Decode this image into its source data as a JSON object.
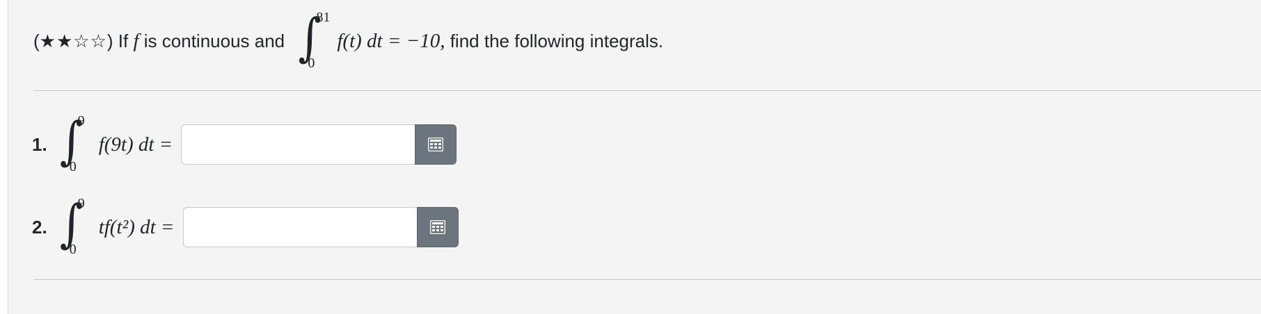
{
  "problem": {
    "difficulty_open": "(",
    "stars": "★★☆☆",
    "difficulty_close": ")",
    "text_before": " If ",
    "var_f": "f",
    "text_middle": " is continuous and ",
    "given_upper": "81",
    "given_lower": "0",
    "given_integrand": "f(t) dt = −10,",
    "text_after": " find the following integrals."
  },
  "questions": [
    {
      "number": "1.",
      "upper": "9",
      "lower": "0",
      "integrand": "f(9t) dt =",
      "input_value": "",
      "keypad_icon": "keypad-grid-icon"
    },
    {
      "number": "2.",
      "upper": "9",
      "lower": "0",
      "integrand": "tf(t²) dt =",
      "input_value": "",
      "keypad_icon": "keypad-grid-icon"
    }
  ],
  "colors": {
    "panel_bg": "#f4f4f4",
    "keypad_button": "#6c757d",
    "divider": "#c8c8c8"
  }
}
